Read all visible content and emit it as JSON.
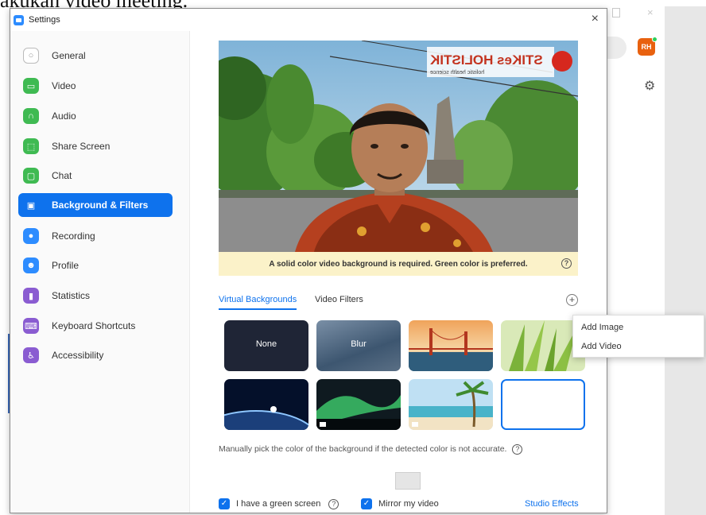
{
  "doc_bg": {
    "text": "akukan video meeting."
  },
  "bg_app": {
    "close_glyph": "×",
    "avatar_text": "RH"
  },
  "window": {
    "title": "Settings",
    "close_glyph": "×"
  },
  "sidebar": {
    "items": [
      {
        "label": "General",
        "icon": "gear-icon",
        "color": "#9a9a9a"
      },
      {
        "label": "Video",
        "icon": "video-icon",
        "color": "#3fba52"
      },
      {
        "label": "Audio",
        "icon": "headphones-icon",
        "color": "#3fba52"
      },
      {
        "label": "Share Screen",
        "icon": "share-screen-icon",
        "color": "#3fba52"
      },
      {
        "label": "Chat",
        "icon": "chat-icon",
        "color": "#3fba52"
      },
      {
        "label": "Background & Filters",
        "icon": "background-icon",
        "color": "#0e72ed",
        "active": true
      },
      {
        "label": "Recording",
        "icon": "recording-icon",
        "color": "#2d8cff"
      },
      {
        "label": "Profile",
        "icon": "profile-icon",
        "color": "#2d8cff"
      },
      {
        "label": "Statistics",
        "icon": "statistics-icon",
        "color": "#8a5cd1"
      },
      {
        "label": "Keyboard Shortcuts",
        "icon": "keyboard-icon",
        "color": "#8a5cd1"
      },
      {
        "label": "Accessibility",
        "icon": "accessibility-icon",
        "color": "#8a5cd1"
      }
    ]
  },
  "preview": {
    "banner_text": "STIKes HOLISTIK",
    "banner_sub": "holistic health science"
  },
  "notice": {
    "text": "A solid color video background is required. Green color is preferred.",
    "help": "?"
  },
  "tabs": [
    {
      "label": "Virtual Backgrounds",
      "active": true
    },
    {
      "label": "Video Filters",
      "active": false
    }
  ],
  "add_button": {
    "glyph": "+"
  },
  "backgrounds": [
    {
      "label": "None"
    },
    {
      "label": "Blur"
    },
    {
      "label": ""
    },
    {
      "label": ""
    },
    {
      "label": ""
    },
    {
      "label": ""
    },
    {
      "label": ""
    },
    {
      "label": ""
    }
  ],
  "hint": {
    "text": "Manually pick the color of the background if the detected color is not accurate.",
    "help": "?"
  },
  "options": {
    "green_screen": {
      "label": "I have a green screen",
      "checked": true,
      "help": "?"
    },
    "mirror": {
      "label": "Mirror my video",
      "checked": true
    },
    "studio_effects": "Studio Effects"
  },
  "menu": {
    "items": [
      "Add Image",
      "Add Video"
    ]
  },
  "colors": {
    "accent": "#0e72ed",
    "notice_bg": "#fbf2c9"
  }
}
